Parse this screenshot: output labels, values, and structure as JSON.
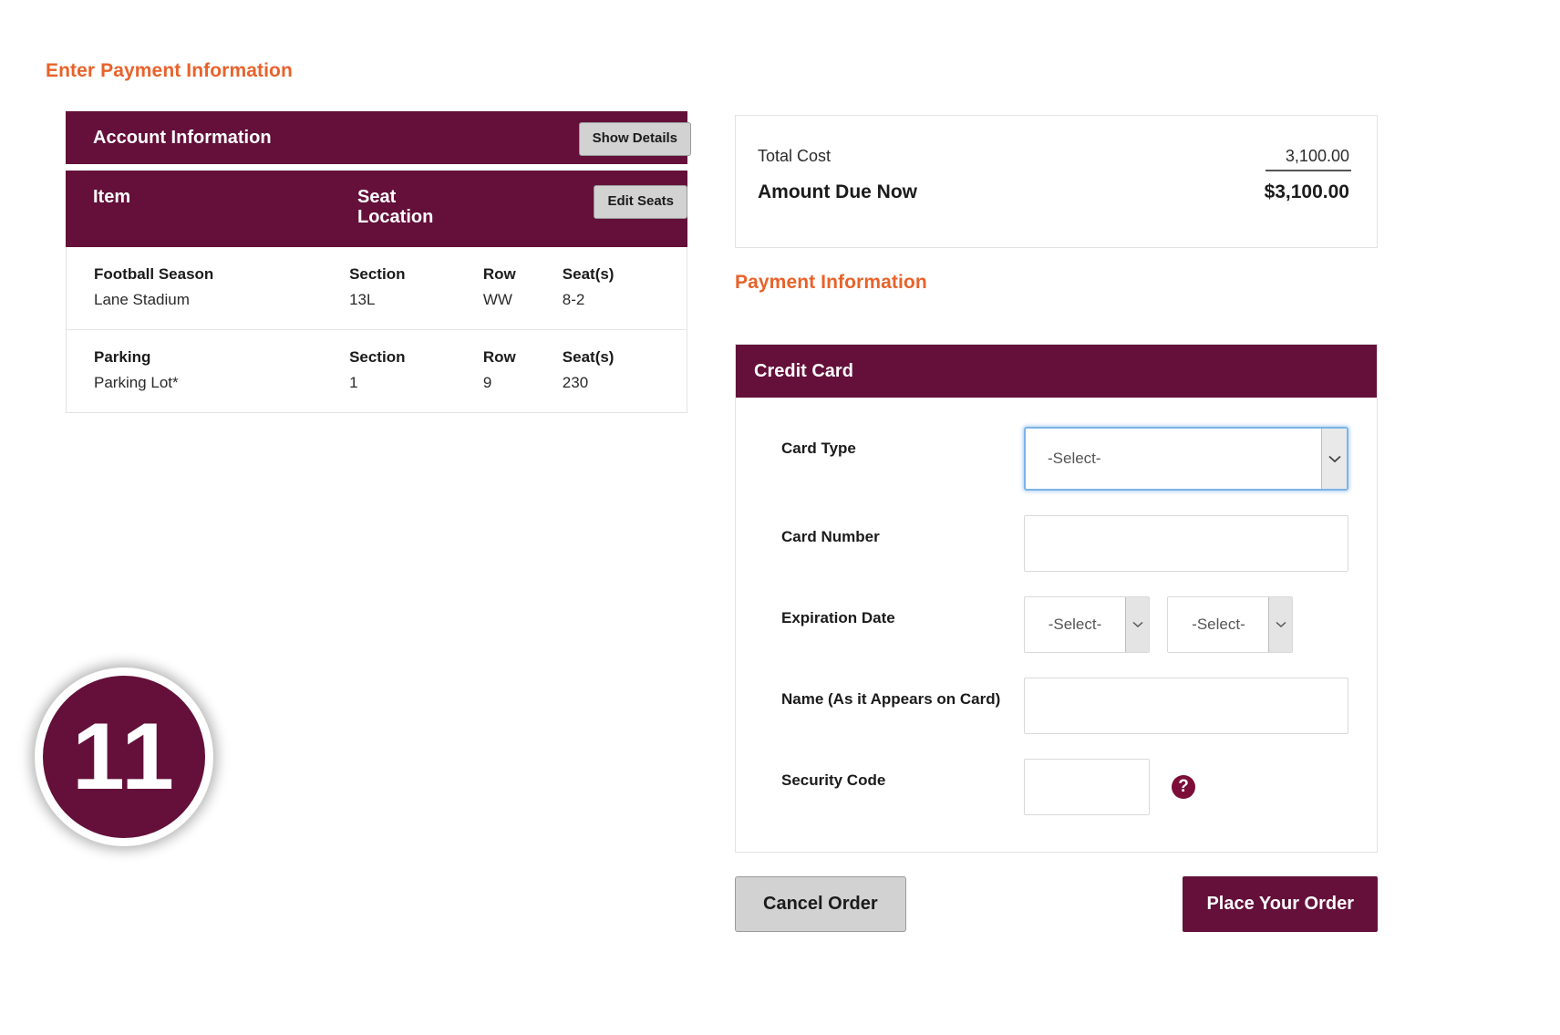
{
  "page": {
    "enter_payment_heading": "Enter Payment Information",
    "payment_information_heading": "Payment Information",
    "step_badge_number": "11"
  },
  "colors": {
    "maroon": "#64103a",
    "orange": "#e8622a",
    "grey_button": "#d2d2d2",
    "focus_blue": "#7cb4e8"
  },
  "account": {
    "title": "Account Information",
    "show_details_label": "Show Details",
    "edit_seats_label": "Edit Seats",
    "columns": {
      "item": "Item",
      "seat_location_line1": "Seat",
      "seat_location_line2": "Location"
    },
    "rows": [
      {
        "label_item": "Football Season",
        "label_section": "Section",
        "label_row": "Row",
        "label_seats": "Seat(s)",
        "value_item": "Lane Stadium",
        "value_section": "13L",
        "value_row": "WW",
        "value_seats": "8-2"
      },
      {
        "label_item": "Parking",
        "label_section": "Section",
        "label_row": "Row",
        "label_seats": "Seat(s)",
        "value_item": "Parking Lot*",
        "value_section": "1",
        "value_row": "9",
        "value_seats": "230"
      }
    ]
  },
  "totals": {
    "total_cost_label": "Total Cost",
    "total_cost_value": "3,100.00",
    "amount_due_label": "Amount Due Now",
    "amount_due_value": "$3,100.00"
  },
  "credit_card": {
    "title": "Credit Card",
    "fields": {
      "card_type_label": "Card Type",
      "card_type_value": "-Select-",
      "card_number_label": "Card Number",
      "card_number_value": "",
      "expiration_label": "Expiration Date",
      "expiration_month_value": "-Select-",
      "expiration_year_value": "-Select-",
      "name_on_card_label": "Name (As it Appears on Card)",
      "name_on_card_value": "",
      "security_code_label": "Security Code",
      "security_code_value": "",
      "security_help_glyph": "?"
    }
  },
  "footer": {
    "cancel_label": "Cancel Order",
    "place_order_label": "Place Your Order"
  }
}
